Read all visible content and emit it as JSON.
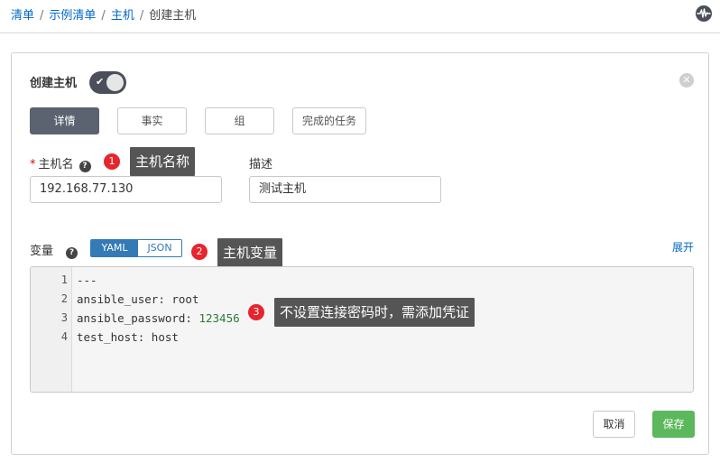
{
  "breadcrumb": {
    "items": [
      "清单",
      "示例清单",
      "主机"
    ],
    "separator": "/",
    "current": "创建主机"
  },
  "header": {
    "activity_icon": "activity-icon"
  },
  "card": {
    "title": "创建主机",
    "toggle_enabled": true,
    "close_icon": "close-icon"
  },
  "tabs": [
    {
      "label": "详情",
      "active": true
    },
    {
      "label": "事实",
      "active": false
    },
    {
      "label": "组",
      "active": false
    },
    {
      "label": "完成的任务",
      "active": false
    }
  ],
  "form": {
    "host_name": {
      "required_mark": "*",
      "label": "主机名",
      "value": "192.168.77.130"
    },
    "description": {
      "label": "描述",
      "value": "测试主机"
    },
    "variables": {
      "label": "变量",
      "format_options": [
        "YAML",
        "JSON"
      ],
      "selected_format": "YAML",
      "expand_label": "展开",
      "line_numbers": [
        "1",
        "2",
        "3",
        "4"
      ],
      "lines": [
        {
          "key": "---",
          "sep": "",
          "value": "",
          "numeric": false
        },
        {
          "key": "ansible_user",
          "sep": ": ",
          "value": "root",
          "numeric": false
        },
        {
          "key": "ansible_password",
          "sep": ": ",
          "value": "123456",
          "numeric": true
        },
        {
          "key": "test_host",
          "sep": ": ",
          "value": "host",
          "numeric": false
        }
      ]
    }
  },
  "annotations": [
    {
      "number": "1",
      "text": "主机名称"
    },
    {
      "number": "2",
      "text": "主机变量"
    },
    {
      "number": "3",
      "text": "不设置连接密码时，需添加凭证"
    }
  ],
  "actions": {
    "cancel_label": "取消",
    "save_label": "保存"
  },
  "colors": {
    "link": "#0066cc",
    "active_tab": "#5b6270",
    "toggle": "#4a4f5a",
    "yaml_selected": "#337ab7",
    "save_button": "#5cb85c",
    "annotation_badge": "#e6252e",
    "annotation_callout": "#555555",
    "required": "#c9190b"
  }
}
